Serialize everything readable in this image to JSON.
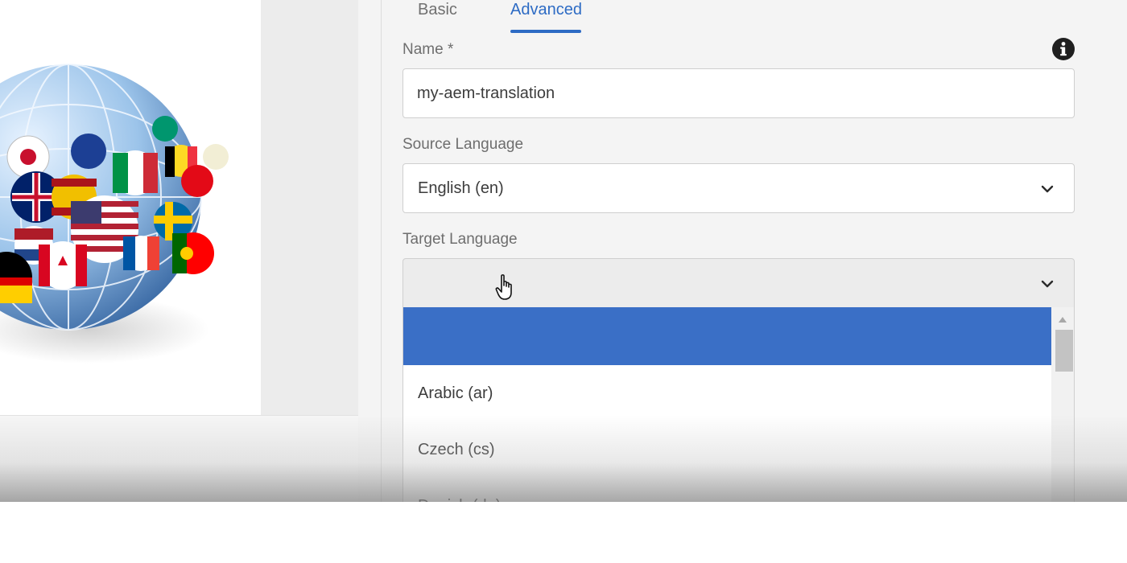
{
  "tabs": [
    {
      "label": "Basic",
      "active": false
    },
    {
      "label": "Advanced",
      "active": true
    }
  ],
  "accent_color": "#2d6bc4",
  "selection_color": "#3a6fc6",
  "form": {
    "name_label": "Name *",
    "name_value": "my-aem-translation",
    "source_label": "Source Language",
    "source_value": "English (en)",
    "target_label": "Target Language",
    "target_value": ""
  },
  "target_options": [
    {
      "label": "",
      "highlighted": true
    },
    {
      "label": "Arabic (ar)",
      "highlighted": false
    },
    {
      "label": "Czech (cs)",
      "highlighted": false
    },
    {
      "label": "Danish (da)",
      "highlighted": false
    }
  ],
  "icons": {
    "info": "info-icon",
    "chevron": "chevron-down-icon",
    "cursor": "hand-pointer-icon",
    "globe": "globe-flags-image"
  }
}
